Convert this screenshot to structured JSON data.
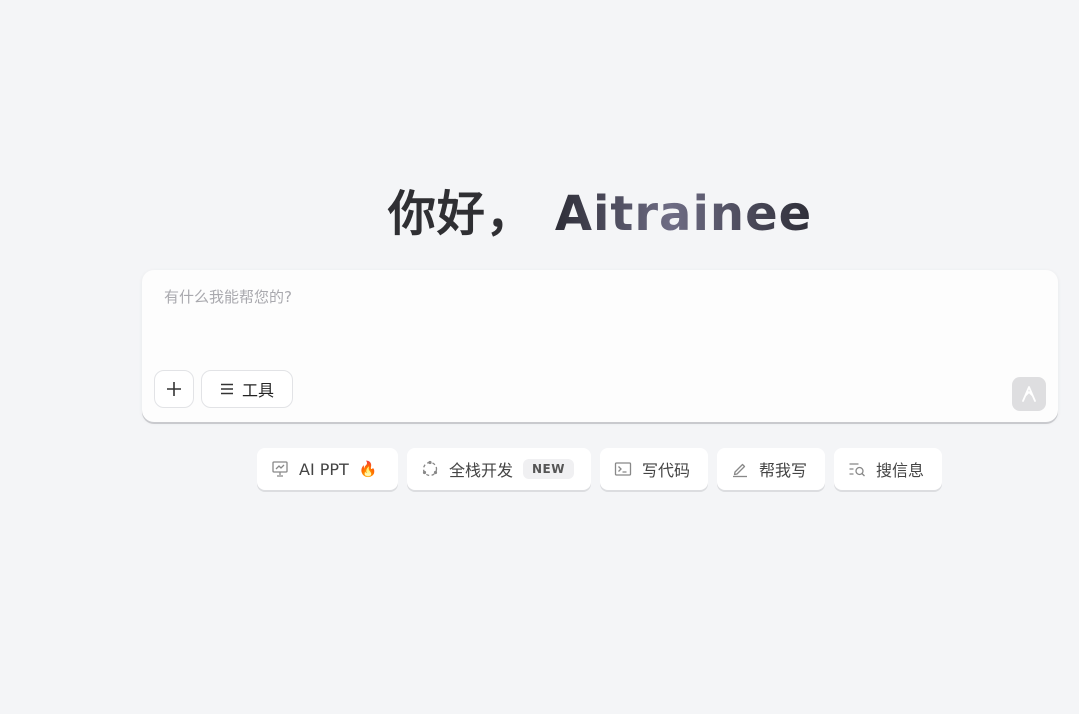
{
  "greeting": {
    "hello": "你好，",
    "name": "Aitrainee"
  },
  "chat": {
    "placeholder": "有什么我能帮您的?",
    "value": "",
    "add_icon": "plus-icon",
    "tools_label": "工具",
    "tools_icon": "menu-lines-icon",
    "send_icon": "send-arrow-icon"
  },
  "chips": [
    {
      "label": "AI PPT",
      "icon": "presentation-icon",
      "extra": "🔥"
    },
    {
      "label": "全栈开发",
      "icon": "dotted-circle-icon",
      "badge": "NEW"
    },
    {
      "label": "写代码",
      "icon": "terminal-icon"
    },
    {
      "label": "帮我写",
      "icon": "pen-icon"
    },
    {
      "label": "搜信息",
      "icon": "search-list-icon"
    }
  ],
  "colors": {
    "background": "#f4f5f7",
    "card": "#fdfdfd",
    "send_disabled": "#dedee0",
    "fire_accent": "#f26b1d"
  }
}
